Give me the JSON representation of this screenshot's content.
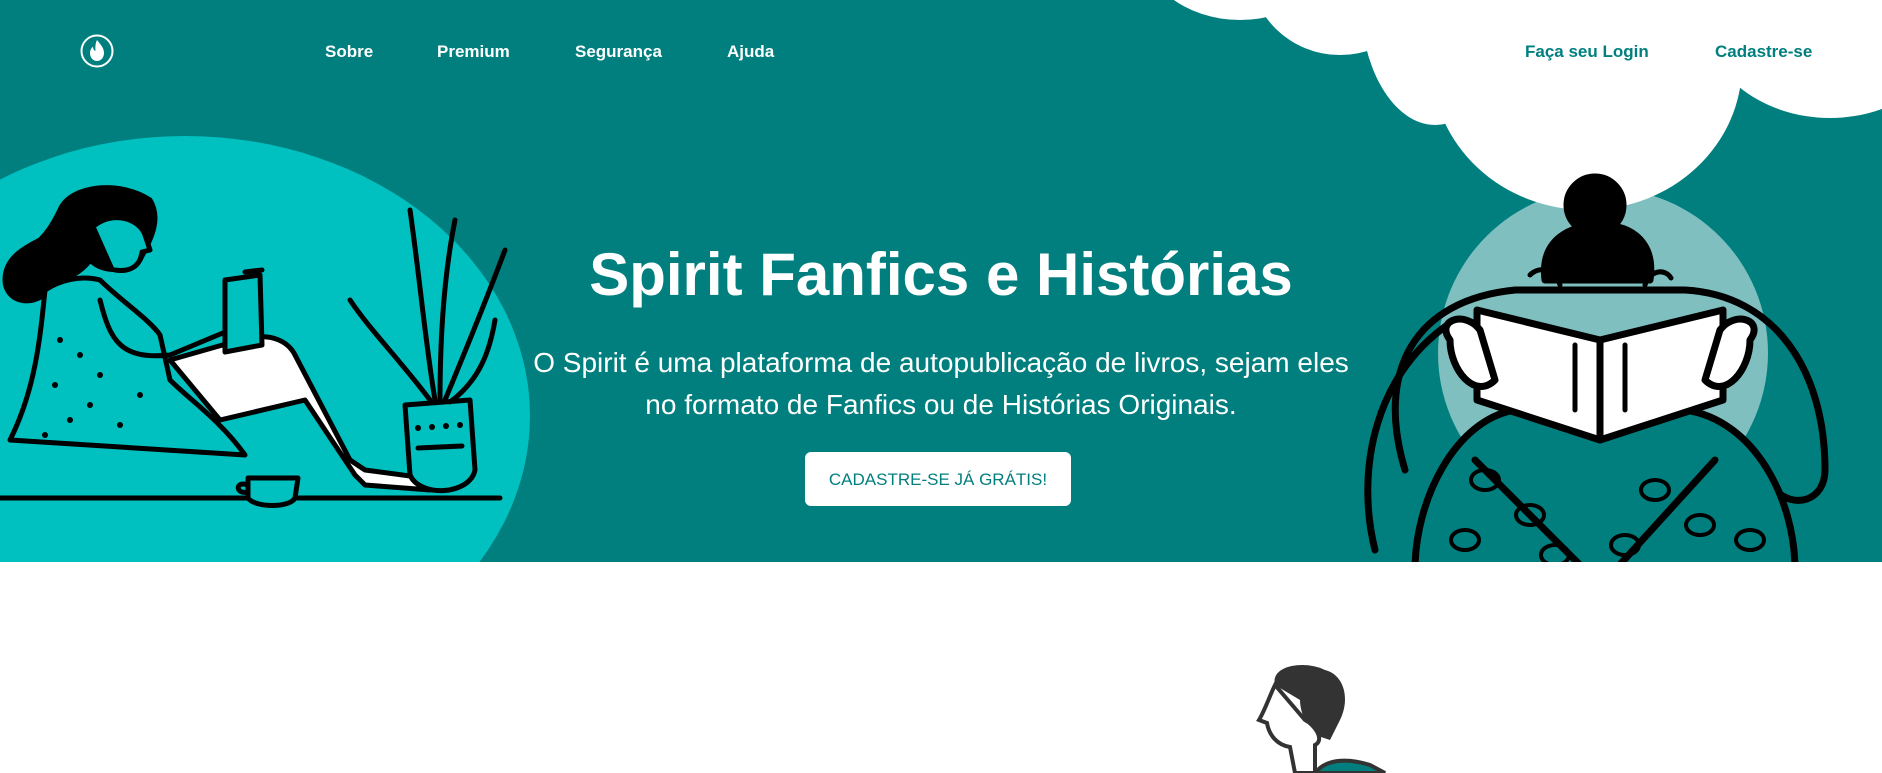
{
  "colors": {
    "primary": "#017f7f",
    "accent_light": "#01c0c0",
    "circle": "#7fbfbf",
    "white": "#ffffff"
  },
  "header": {
    "logo_icon": "flame-icon",
    "nav_left": [
      {
        "label": "Sobre"
      },
      {
        "label": "Premium"
      },
      {
        "label": "Segurança"
      },
      {
        "label": "Ajuda"
      }
    ],
    "nav_right": [
      {
        "label": "Faça seu Login"
      },
      {
        "label": "Cadastre-se"
      }
    ]
  },
  "hero": {
    "title": "Spirit Fanfics e Histórias",
    "description": "O Spirit é uma plataforma de autopublicação de livros, sejam eles no formato de Fanfics ou de Histórias Originais.",
    "cta_label": "CADASTRE-SE JÁ GRÁTIS!"
  },
  "illustrations": [
    "woman-reading-illustration",
    "plant-pot-illustration",
    "coffee-cup-illustration",
    "person-reading-book-illustration",
    "person-profile-illustration"
  ]
}
